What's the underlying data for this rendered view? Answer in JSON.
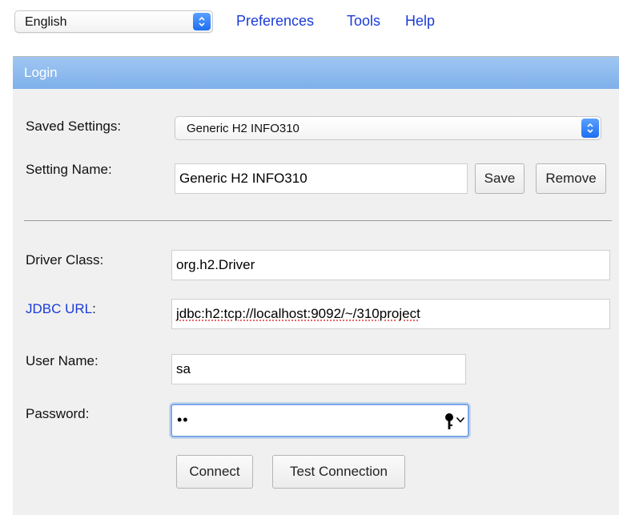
{
  "topbar": {
    "language": "English",
    "links": {
      "preferences": "Preferences",
      "tools": "Tools",
      "help": "Help"
    }
  },
  "login": {
    "header": "Login",
    "saved_settings_label": "Saved Settings:",
    "saved_settings_value": "Generic H2 INFO310",
    "setting_name_label": "Setting Name:",
    "setting_name_value": "Generic H2 INFO310",
    "save_button": "Save",
    "remove_button": "Remove",
    "driver_class_label": "Driver Class:",
    "driver_class_value": "org.h2.Driver",
    "jdbc_url_label": "JDBC URL",
    "jdbc_url_colon": ":",
    "jdbc_url_value": "jdbc:h2:tcp://localhost:9092/~/310project",
    "user_name_label": "User Name:",
    "user_name_value": "sa",
    "password_label": "Password:",
    "password_value": "••",
    "connect_button": "Connect",
    "test_connection_button": "Test Connection"
  },
  "colors": {
    "link": "#1a3bd6",
    "header_bg": "#8fbbee",
    "panel_bg": "#f0f0f0",
    "focus": "#7aa7e6"
  },
  "icons": {
    "language_stepper": "stepper-arrows-icon",
    "saved_stepper": "stepper-arrows-icon",
    "password_key": "key-icon",
    "password_chevron": "chevron-down-icon"
  }
}
